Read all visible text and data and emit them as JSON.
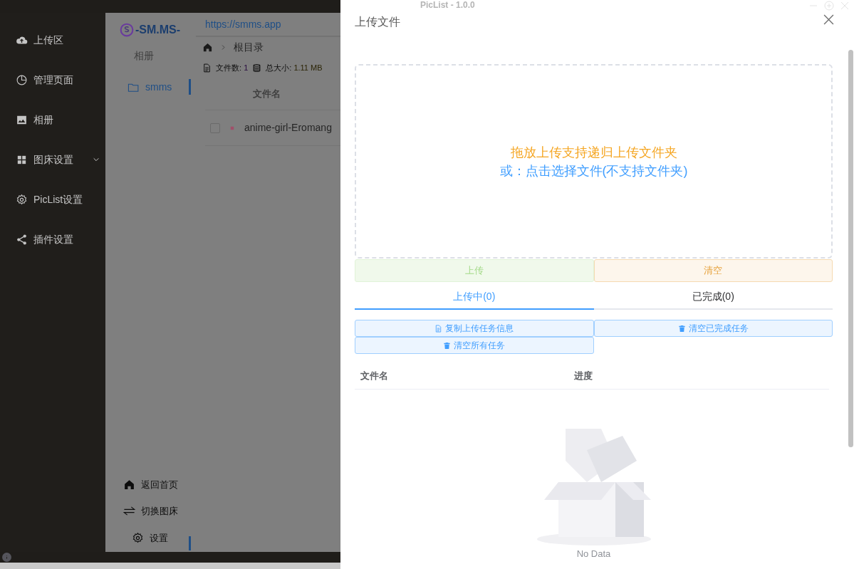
{
  "title_bar": {
    "title": "PicList - 1.0.0"
  },
  "sidebar": {
    "items": [
      {
        "label": "上传区",
        "kind": "link"
      },
      {
        "label": "管理页面",
        "kind": "link"
      },
      {
        "label": "相册",
        "kind": "link"
      },
      {
        "label": "图床设置",
        "kind": "group"
      },
      {
        "label": "PicList设置",
        "kind": "link"
      },
      {
        "label": "插件设置",
        "kind": "link"
      }
    ]
  },
  "manager": {
    "logo_text": "-SM.MS-",
    "url": "https://smms.app",
    "album_heading": "相册",
    "albums": [
      {
        "label": "smms",
        "selected": true
      }
    ],
    "breadcrumb": [
      "根目录"
    ],
    "stats": {
      "file_count_label": "文件数:",
      "file_count": "1",
      "total_size_label": "总大小:",
      "total_size": "1.11 MB"
    },
    "table": {
      "columns": [
        "文件名"
      ],
      "rows": [
        {
          "checked": false,
          "name": "anime-girl-Eromang"
        }
      ]
    },
    "footer_links": [
      {
        "label": "返回首页"
      },
      {
        "label": "切换图床"
      },
      {
        "label": "设置"
      }
    ]
  },
  "upload_drawer": {
    "title": "上传文件",
    "drop_zone": {
      "line_1": "拖放上传支持递归上传文件夹",
      "line_2": "或：点击选择文件(不支持文件夹)"
    },
    "buttons": [
      {
        "label": "上传",
        "kind": "success"
      },
      {
        "label": "清空",
        "kind": "warning"
      }
    ],
    "tabs": [
      {
        "label": "上传中(0)",
        "selected": true
      },
      {
        "label": "已完成(0)",
        "selected": false
      }
    ],
    "task_buttons": [
      {
        "label": "复制上传任务信息"
      },
      {
        "label": "清空已完成任务"
      },
      {
        "label": "清空所有任务"
      }
    ],
    "table": {
      "columns": [
        "文件名",
        "进度"
      ],
      "empty_text": "No Data"
    }
  }
}
